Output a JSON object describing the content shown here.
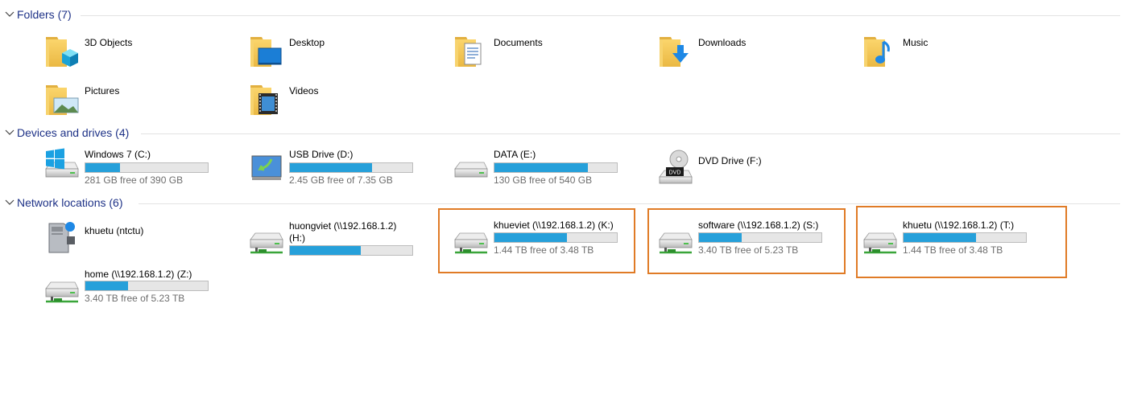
{
  "groups": {
    "folders": {
      "title": "Folders (7)"
    },
    "devices": {
      "title": "Devices and drives (4)"
    },
    "network": {
      "title": "Network locations (6)"
    }
  },
  "folders": [
    {
      "name": "3D Objects",
      "icon": "3d-objects-folder-icon"
    },
    {
      "name": "Desktop",
      "icon": "desktop-folder-icon"
    },
    {
      "name": "Documents",
      "icon": "documents-folder-icon"
    },
    {
      "name": "Downloads",
      "icon": "downloads-folder-icon"
    },
    {
      "name": "Music",
      "icon": "music-folder-icon"
    },
    {
      "name": "Pictures",
      "icon": "pictures-folder-icon"
    },
    {
      "name": "Videos",
      "icon": "videos-folder-icon"
    }
  ],
  "drives": [
    {
      "name": "Windows 7 (C:)",
      "free": "281 GB free of 390 GB",
      "used_fraction": 0.28,
      "icon": "windows-drive-icon"
    },
    {
      "name": "USB Drive (D:)",
      "free": "2.45 GB free of 7.35 GB",
      "used_fraction": 0.67,
      "icon": "usb-drive-icon"
    },
    {
      "name": "DATA (E:)",
      "free": "130 GB free of 540 GB",
      "used_fraction": 0.76,
      "icon": "hard-drive-icon"
    },
    {
      "name": "DVD Drive (F:)",
      "icon": "dvd-drive-icon"
    }
  ],
  "network": [
    {
      "name": "khuetu (ntctu)",
      "icon": "network-computer-icon"
    },
    {
      "name": "huongviet (\\\\192.168.1.2)",
      "name2": "(H:)",
      "used_fraction": 0.58,
      "icon": "network-drive-icon"
    },
    {
      "name": "khueviet (\\\\192.168.1.2) (K:)",
      "free": "1.44 TB free of 3.48 TB",
      "used_fraction": 0.59,
      "icon": "network-drive-icon"
    },
    {
      "name": "software (\\\\192.168.1.2) (S:)",
      "free": "3.40 TB free of 5.23 TB",
      "used_fraction": 0.35,
      "icon": "network-drive-icon"
    },
    {
      "name": "khuetu (\\\\192.168.1.2) (T:)",
      "free": "1.44 TB free of 3.48 TB",
      "used_fraction": 0.59,
      "icon": "network-drive-icon"
    },
    {
      "name": "home (\\\\192.168.1.2) (Z:)",
      "free": "3.40 TB free of 5.23 TB",
      "used_fraction": 0.35,
      "icon": "network-drive-icon"
    }
  ],
  "colors": {
    "accent": "#26a0da",
    "header": "#1e3287",
    "highlight": "#e07b26",
    "folder": "#f5c85a"
  }
}
